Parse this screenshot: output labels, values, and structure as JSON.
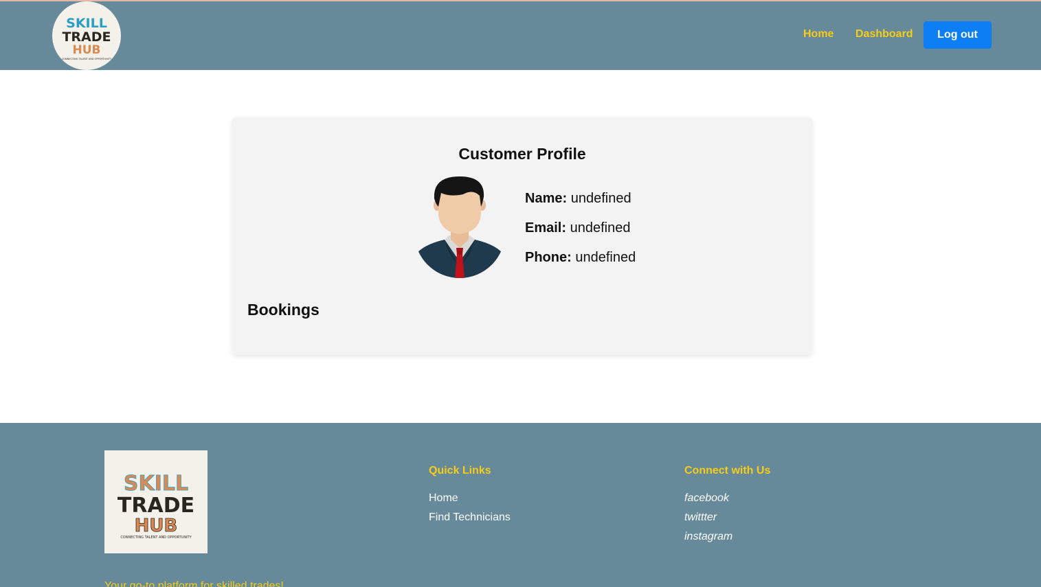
{
  "header": {
    "logo": {
      "line1": "SKILL",
      "line2": "TRADE",
      "line3": "HUB",
      "tagline": "CONNECTING TALENT AND OPPORTUNITY"
    },
    "nav": {
      "home_label": "Home",
      "dashboard_label": "Dashboard",
      "logout_label": "Log out"
    }
  },
  "profile": {
    "title": "Customer Profile",
    "avatar_icon": "businessman-avatar-icon",
    "name_label": "Name:",
    "name_value": "undefined",
    "email_label": "Email:",
    "email_value": "undefined",
    "phone_label": "Phone:",
    "phone_value": "undefined",
    "bookings_title": "Bookings"
  },
  "footer": {
    "logo": {
      "line1": "SKILL",
      "line2": "TRADE",
      "line3": "HUB",
      "tagline": "CONNECTING TALENT AND OPPORTUNITY"
    },
    "quick_links_title": "Quick Links",
    "quick_links": [
      "Home",
      "Find Technicians"
    ],
    "connect_title": "Connect with Us",
    "social_links": [
      "facebook",
      "twittter",
      "instagram"
    ],
    "tagline": "Your go-to platform for skilled trades!"
  },
  "colors": {
    "header_bg": "#668a99",
    "accent_yellow": "#f6cc19",
    "button_blue": "#0d7ef3",
    "card_bg": "#f3f3f3"
  }
}
